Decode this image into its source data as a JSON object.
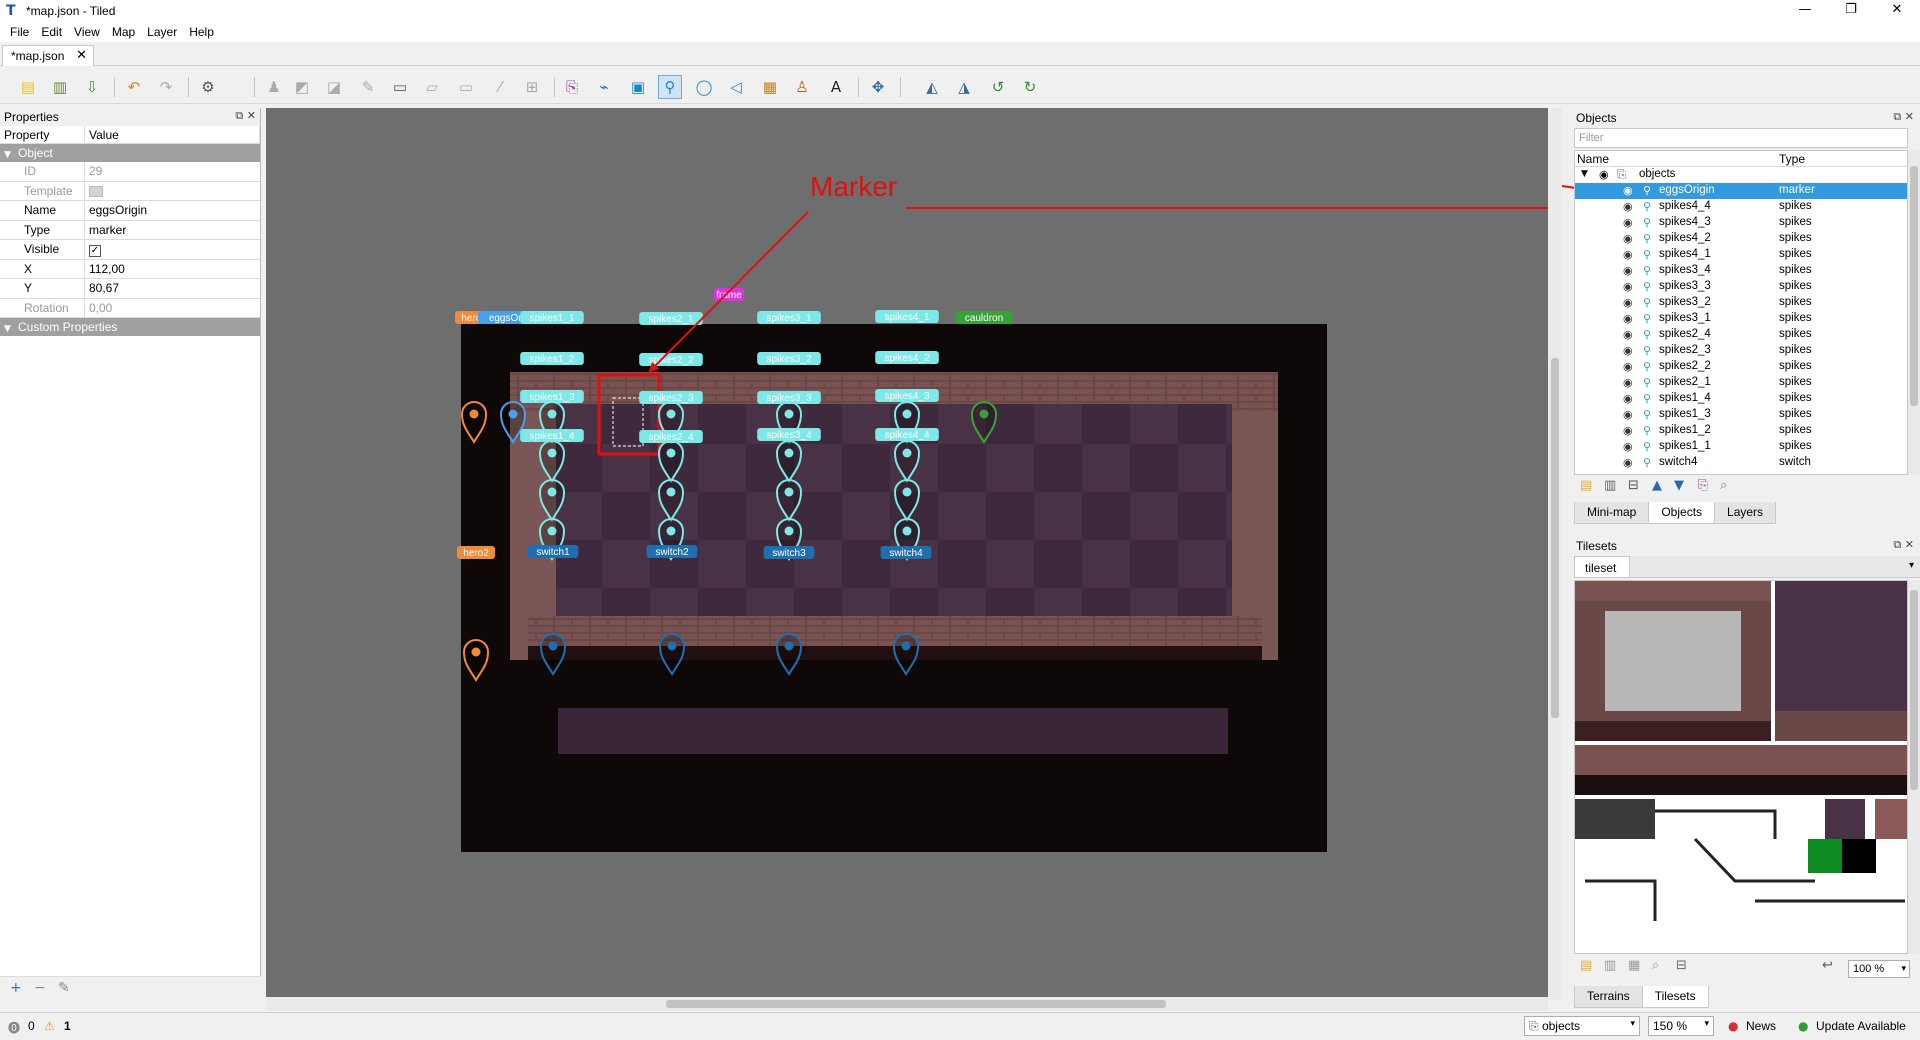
{
  "window": {
    "title": "*map.json - Tiled",
    "app_icon": "T",
    "minimize_glyph": "—",
    "restore_glyph": "❐",
    "close_glyph": "✕"
  },
  "menu": [
    "File",
    "Edit",
    "View",
    "Map",
    "Layer",
    "Help"
  ],
  "document_tab": {
    "label": "*map.json",
    "close_glyph": "✕"
  },
  "toolbar": {
    "icons": [
      "new-map",
      "open",
      "save",
      "undo",
      "redo",
      "commands",
      "stamp-brush",
      "terrain-brush",
      "bucket-fill",
      "shape-fill",
      "eraser",
      "rectangular-select",
      "magic-wand",
      "select-same-tile",
      "insert-template",
      "select-objects",
      "edit-polygons",
      "insert-rectangle",
      "insert-point",
      "insert-ellipse",
      "insert-polygon",
      "insert-tile",
      "insert-template-object",
      "insert-text",
      "random-mode",
      "flip-horizontal",
      "flip-vertical",
      "rotate-left",
      "rotate-right"
    ]
  },
  "properties": {
    "title": "Properties",
    "col_property": "Property",
    "col_value": "Value",
    "group_object": "Object",
    "rows": [
      {
        "key": "ID",
        "value": "29",
        "disabled": true
      },
      {
        "key": "Template",
        "value": "",
        "disabled": true
      },
      {
        "key": "Name",
        "value": "eggsOrigin",
        "disabled": false
      },
      {
        "key": "Type",
        "value": "marker",
        "disabled": false
      },
      {
        "key": "Visible",
        "value": "✓",
        "disabled": false
      },
      {
        "key": "X",
        "value": "112,00",
        "disabled": false
      },
      {
        "key": "Y",
        "value": "80,67",
        "disabled": false
      },
      {
        "key": "Rotation",
        "value": "0,00",
        "disabled": true
      }
    ],
    "group_custom": "Custom Properties"
  },
  "annotation": {
    "label": "Marker",
    "color": "#e01010"
  },
  "map": {
    "frame_label": "frame",
    "objects": [
      {
        "name": "hero1",
        "color": "#f08a3c"
      },
      {
        "name": "eggsOrigin",
        "color": "#4aa0e8"
      },
      {
        "name": "spikes1_1",
        "color": "#7ee8e8"
      },
      {
        "name": "spikes1_2",
        "color": "#7ee8e8"
      },
      {
        "name": "spikes1_3",
        "color": "#7ee8e8"
      },
      {
        "name": "spikes1_4",
        "color": "#7ee8e8"
      },
      {
        "name": "spikes2_1",
        "color": "#7ee8e8"
      },
      {
        "name": "spikes2_2",
        "color": "#7ee8e8"
      },
      {
        "name": "spikes2_3",
        "color": "#7ee8e8"
      },
      {
        "name": "spikes2_4",
        "color": "#7ee8e8"
      },
      {
        "name": "spikes3_1",
        "color": "#7ee8e8"
      },
      {
        "name": "spikes3_2",
        "color": "#7ee8e8"
      },
      {
        "name": "spikes3_3",
        "color": "#7ee8e8"
      },
      {
        "name": "spikes3_4",
        "color": "#7ee8e8"
      },
      {
        "name": "spikes4_1",
        "color": "#7ee8e8"
      },
      {
        "name": "spikes4_2",
        "color": "#7ee8e8"
      },
      {
        "name": "spikes4_3",
        "color": "#7ee8e8"
      },
      {
        "name": "spikes4_4",
        "color": "#7ee8e8"
      },
      {
        "name": "cauldron",
        "color": "#3aa03a"
      },
      {
        "name": "hero2",
        "color": "#f08a3c"
      },
      {
        "name": "switch1",
        "color": "#1f6fb0"
      },
      {
        "name": "switch2",
        "color": "#1f6fb0"
      },
      {
        "name": "switch3",
        "color": "#1f6fb0"
      },
      {
        "name": "switch4",
        "color": "#1f6fb0"
      }
    ]
  },
  "objects_panel": {
    "title": "Objects",
    "filter_placeholder": "Filter",
    "col_name": "Name",
    "col_type": "Type",
    "layer_name": "objects",
    "rows": [
      {
        "name": "eggsOrigin",
        "type": "marker",
        "selected": true
      },
      {
        "name": "spikes4_4",
        "type": "spikes"
      },
      {
        "name": "spikes4_3",
        "type": "spikes"
      },
      {
        "name": "spikes4_2",
        "type": "spikes"
      },
      {
        "name": "spikes4_1",
        "type": "spikes"
      },
      {
        "name": "spikes3_4",
        "type": "spikes"
      },
      {
        "name": "spikes3_3",
        "type": "spikes"
      },
      {
        "name": "spikes3_2",
        "type": "spikes"
      },
      {
        "name": "spikes3_1",
        "type": "spikes"
      },
      {
        "name": "spikes2_4",
        "type": "spikes"
      },
      {
        "name": "spikes2_3",
        "type": "spikes"
      },
      {
        "name": "spikes2_2",
        "type": "spikes"
      },
      {
        "name": "spikes2_1",
        "type": "spikes"
      },
      {
        "name": "spikes1_4",
        "type": "spikes"
      },
      {
        "name": "spikes1_3",
        "type": "spikes"
      },
      {
        "name": "spikes1_2",
        "type": "spikes"
      },
      {
        "name": "spikes1_1",
        "type": "spikes"
      },
      {
        "name": "switch4",
        "type": "switch"
      }
    ],
    "tabs": [
      "Mini-map",
      "Objects",
      "Layers"
    ],
    "active_tab": "Objects"
  },
  "tilesets_panel": {
    "title": "Tilesets",
    "tab": "tileset",
    "zoom": "100 %",
    "tabs": [
      "Terrains",
      "Tilesets"
    ],
    "active_tab": "Tilesets"
  },
  "status": {
    "errors": "0",
    "warnings": "1",
    "layer_combo": "objects",
    "zoom_combo": "150 %",
    "news": "News",
    "update": "Update Available"
  }
}
